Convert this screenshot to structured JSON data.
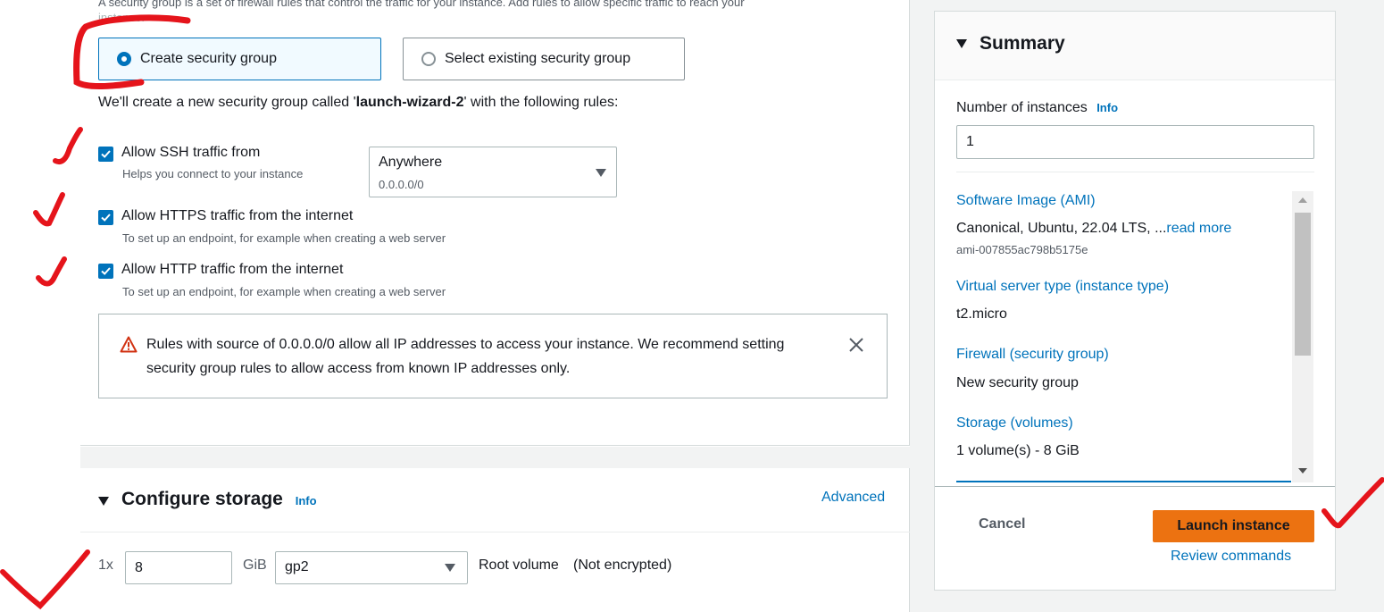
{
  "network": {
    "intro_line1": "A security group is a set of firewall rules that control the traffic for your instance. Add rules to allow specific traffic to reach your",
    "intro_line2": "instance.",
    "create_sg_label": "Create security group",
    "select_sg_label": "Select existing security group",
    "rules_prefix": "We'll create a new security group called '",
    "rules_name": "launch-wizard-2",
    "rules_suffix": "' with the following rules:",
    "ssh": {
      "label": "Allow SSH traffic from",
      "help": "Helps you connect to your instance",
      "checked": true,
      "source_value": "Anywhere",
      "source_sub": "0.0.0.0/0"
    },
    "https": {
      "label": "Allow HTTPS traffic from the internet",
      "help": "To set up an endpoint, for example when creating a web server",
      "checked": true
    },
    "http": {
      "label": "Allow HTTP traffic from the internet",
      "help": "To set up an endpoint, for example when creating a web server",
      "checked": true
    },
    "warning_line1": "Rules with source of 0.0.0.0/0 allow all IP addresses to access your instance. We recommend setting",
    "warning_line2": "security group rules to allow access from known IP addresses only."
  },
  "storage": {
    "title": "Configure storage",
    "info": "Info",
    "advanced": "Advanced",
    "count_prefix": "1x",
    "size_value": "8",
    "unit": "GiB",
    "volume_type": "gp2",
    "root_volume": "Root volume",
    "encryption": "(Not encrypted)"
  },
  "summary": {
    "title": "Summary",
    "instances_label": "Number of instances",
    "instances_info": "Info",
    "instances_value": "1",
    "ami_link": "Software Image (AMI)",
    "ami_value": "Canonical, Ubuntu, 22.04 LTS, ...",
    "ami_read_more": "read more",
    "ami_id": "ami-007855ac798b5175e",
    "type_link": "Virtual server type (instance type)",
    "type_value": "t2.micro",
    "firewall_link": "Firewall (security group)",
    "firewall_value": "New security group",
    "storage_link": "Storage (volumes)",
    "storage_value": "1 volume(s) - 8 GiB",
    "cancel": "Cancel",
    "launch": "Launch instance",
    "review": "Review commands"
  },
  "colors": {
    "accent_blue": "#0073bb",
    "launch_orange": "#ec7211",
    "annotation_red": "#e5141b",
    "warning_red": "#d13212"
  }
}
